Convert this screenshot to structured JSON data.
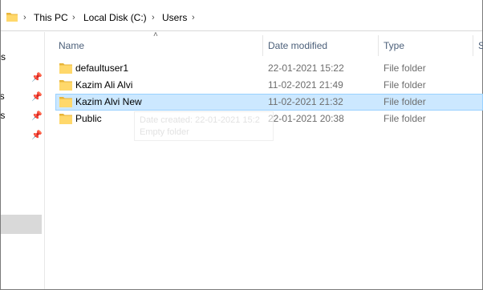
{
  "breadcrumb": {
    "items": [
      "This PC",
      "Local Disk (C:)",
      "Users"
    ]
  },
  "navigation": {
    "items": [
      "ss",
      "ls",
      "ts"
    ]
  },
  "columns": {
    "name": "Name",
    "date_modified": "Date modified",
    "type": "Type",
    "size": "S"
  },
  "files": [
    {
      "name": "defaultuser1",
      "date": "22-01-2021 15:22",
      "type": "File folder",
      "selected": false
    },
    {
      "name": "Kazim Ali Alvi",
      "date": "11-02-2021 21:49",
      "type": "File folder",
      "selected": false
    },
    {
      "name": "Kazim Alvi New",
      "date": "11-02-2021 21:32",
      "type": "File folder",
      "selected": true
    },
    {
      "name": "Public",
      "date": "22-01-2021 20:38",
      "type": "File folder",
      "selected": false
    }
  ],
  "tooltip": {
    "line1": "Date created: 22-01-2021 15:2",
    "line2": "Empty folder"
  },
  "icons": {
    "folder": "folder-icon",
    "pin": "pin-icon",
    "chevron": "chevron-right-icon",
    "sort": "sort-up-icon"
  },
  "colors": {
    "selection_bg": "#cce8ff",
    "selection_border": "#99d1ff",
    "header_text": "#4c607a",
    "folder_yellow": "#ffd86b"
  }
}
